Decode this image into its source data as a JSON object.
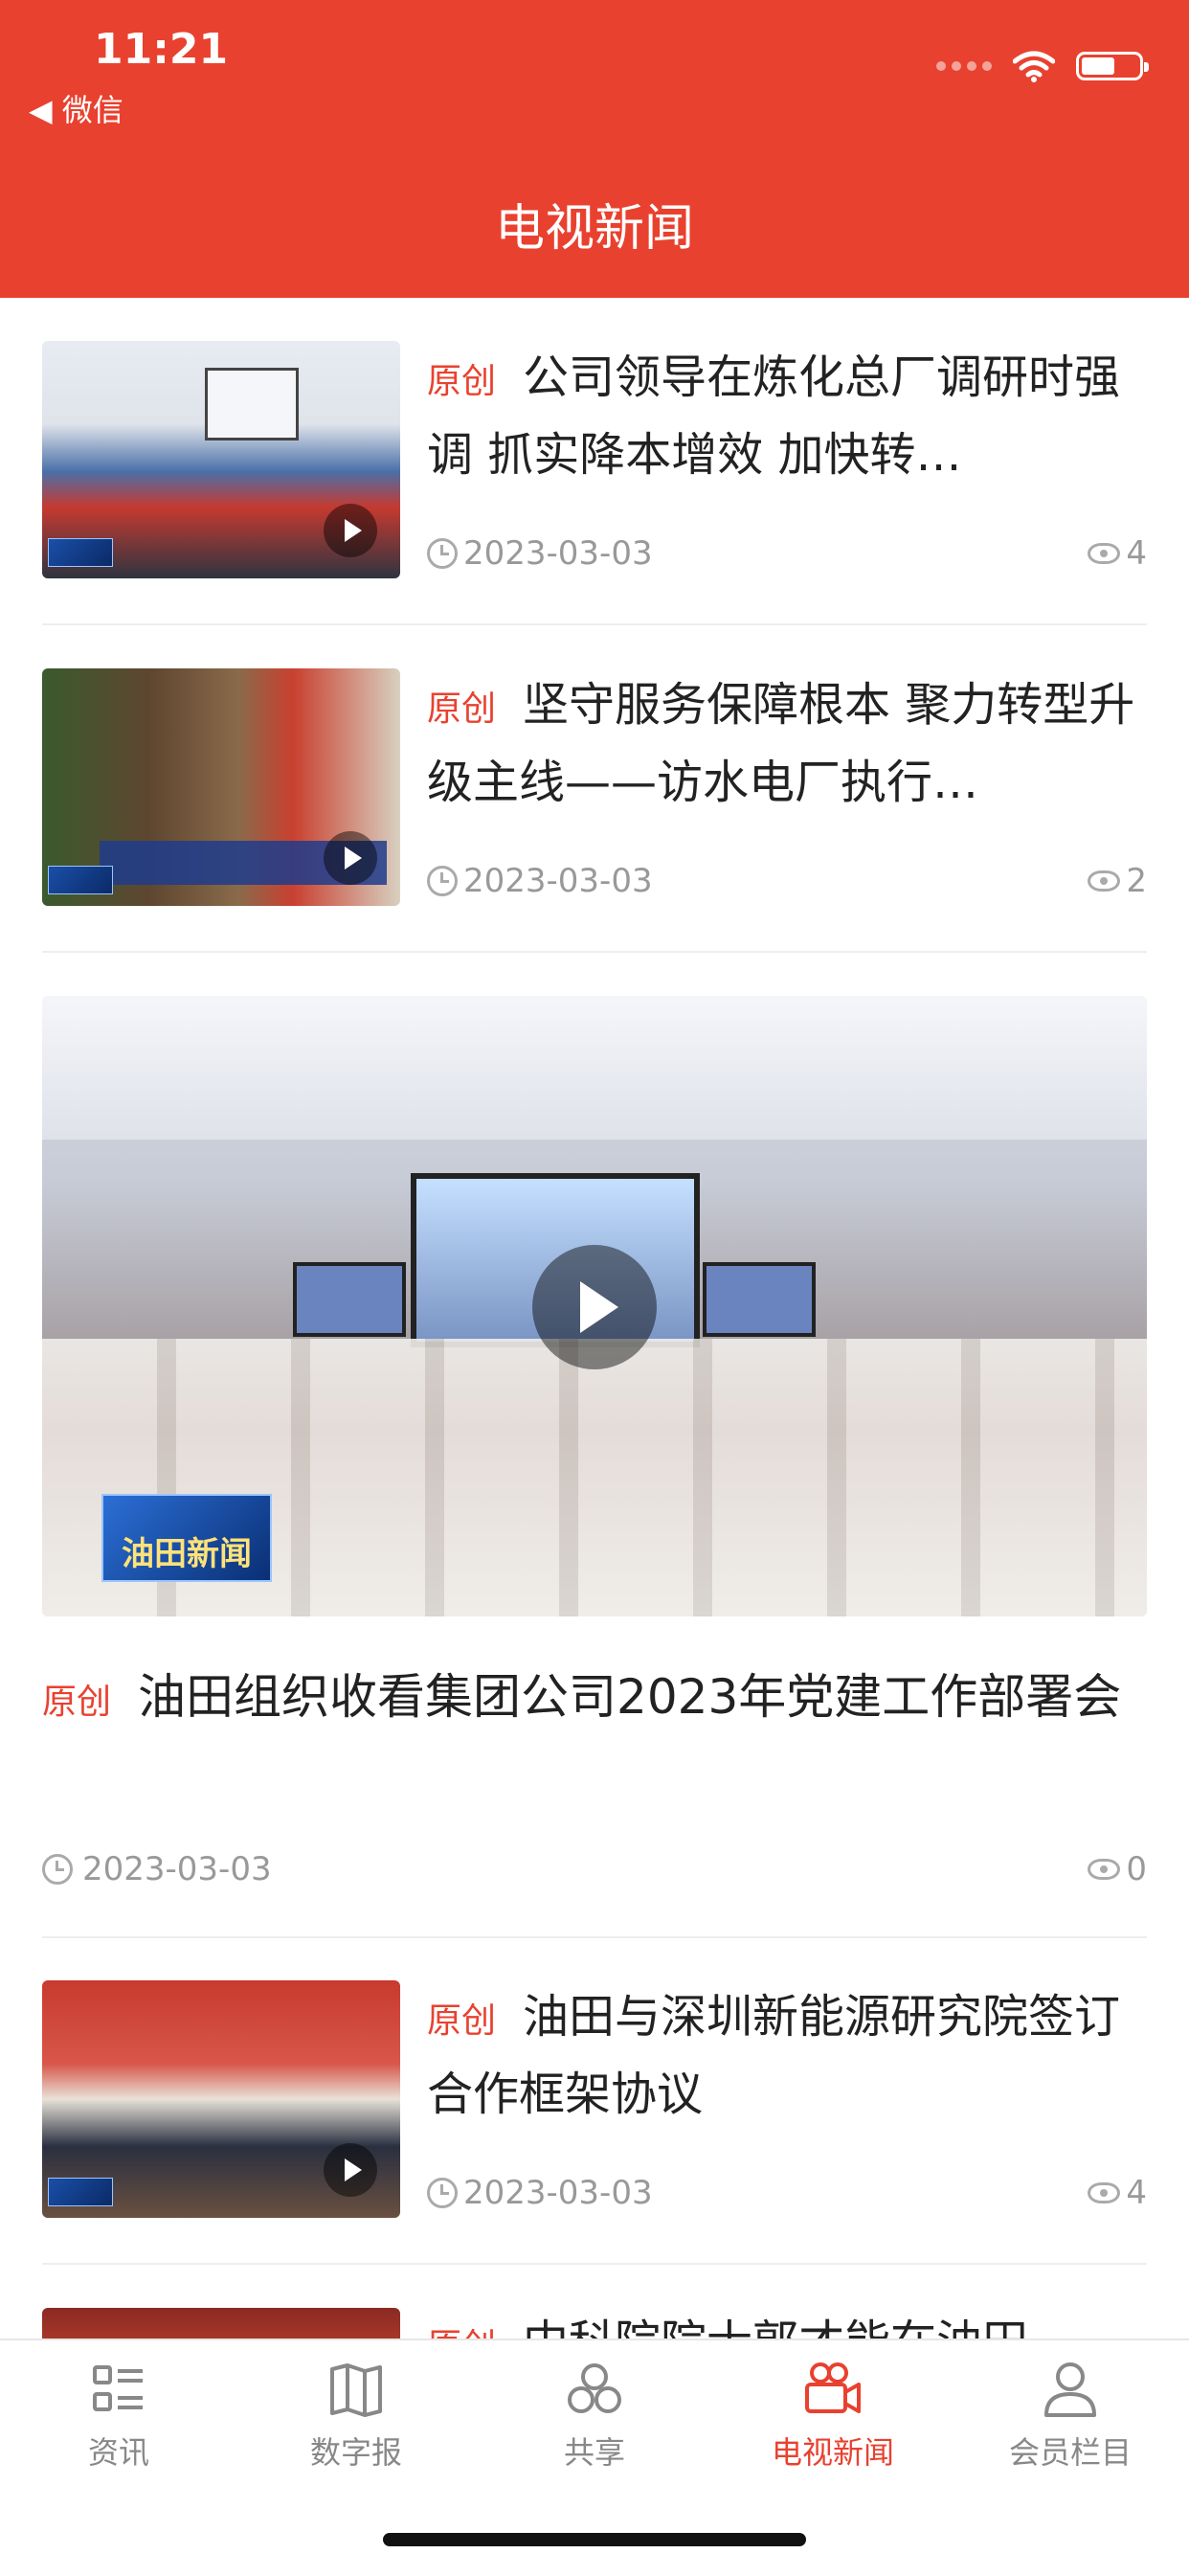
{
  "status": {
    "time": "11:21",
    "back_label": "◀ 微信"
  },
  "header": {
    "title": "电视新闻"
  },
  "colors": {
    "accent": "#e9412f",
    "meta": "#999999"
  },
  "articles": [
    {
      "tag": "原创",
      "title": "公司领导在炼化总厂调研时强调 抓实降本增效 加快转…",
      "date": "2023-03-03",
      "views": "4",
      "icon": "play-icon"
    },
    {
      "tag": "原创",
      "title": "坚守服务保障根本  聚力转型升级主线——访水电厂执行…",
      "date": "2023-03-03",
      "views": "2",
      "icon": "play-icon"
    },
    {
      "tag": "原创",
      "title": "油田组织收看集团公司2023年党建工作部署会",
      "date": "2023-03-03",
      "views": "0",
      "logo_text": "油田新闻"
    },
    {
      "tag": "原创",
      "title": "油田与深圳新能源研究院签订合作框架协议",
      "date": "2023-03-03",
      "views": "4",
      "icon": "play-icon"
    },
    {
      "tag": "原创",
      "title": "中科院院士郭才能在油田…"
    }
  ],
  "tabs": [
    {
      "label": "资讯",
      "icon": "list-icon",
      "active": false
    },
    {
      "label": "数字报",
      "icon": "newspaper-icon",
      "active": false
    },
    {
      "label": "共享",
      "icon": "share-icon",
      "active": false
    },
    {
      "label": "电视新闻",
      "icon": "video-camera-icon",
      "active": true
    },
    {
      "label": "会员栏目",
      "icon": "user-icon",
      "active": false
    }
  ]
}
